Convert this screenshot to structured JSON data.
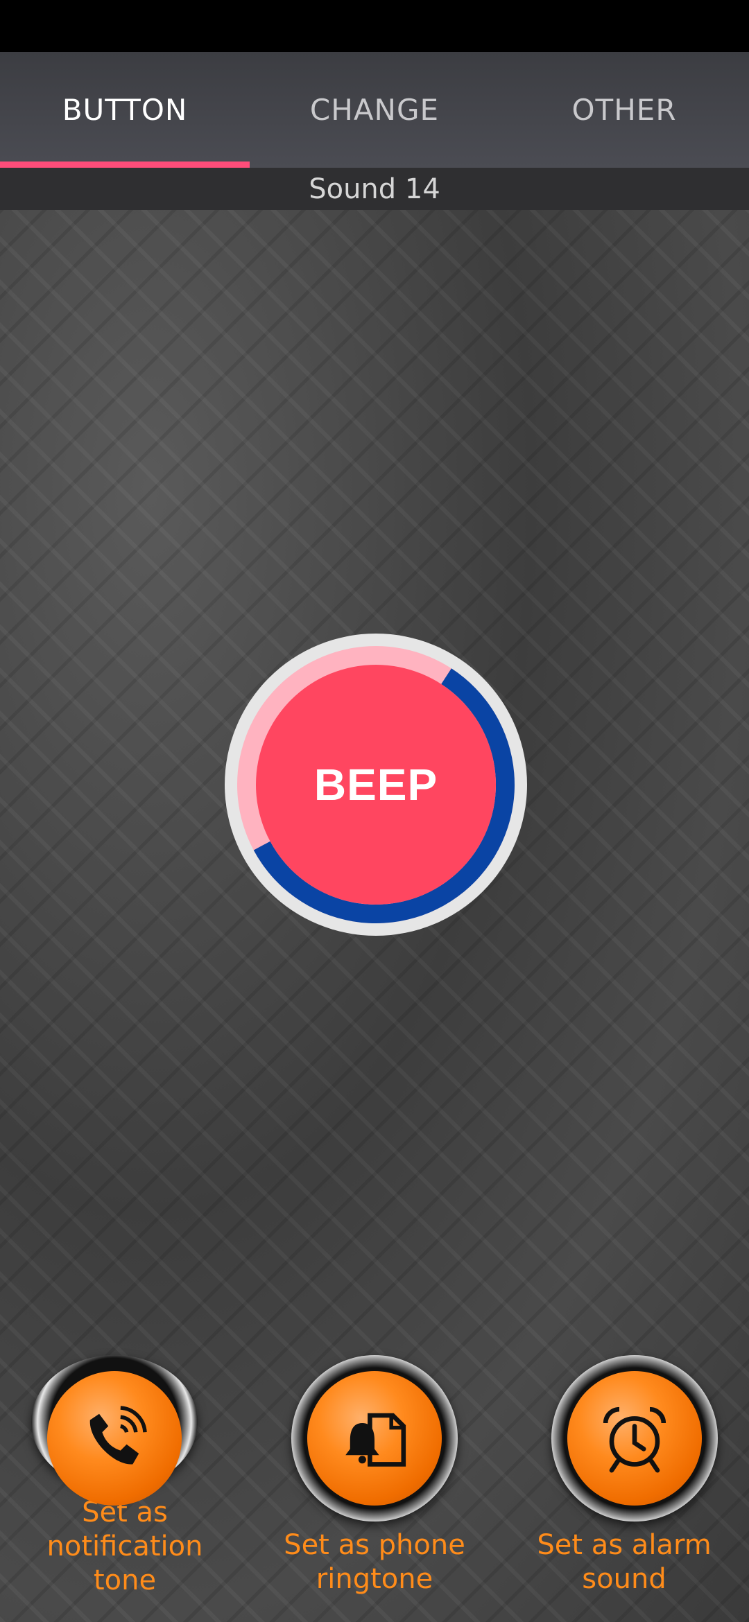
{
  "tabs": [
    {
      "label": "BUTTON",
      "active": true
    },
    {
      "label": "CHANGE",
      "active": false
    },
    {
      "label": "OTHER",
      "active": false
    }
  ],
  "sound_title": "Sound 14",
  "beep_button": {
    "label": "BEEP",
    "progress_fraction": 0.58,
    "colors": {
      "face": "#ff4660",
      "progress": "#0a44a4",
      "track": "#ffb3c0",
      "rim": "#e6e6e6"
    }
  },
  "actions": [
    {
      "label_line1": "Set as notification",
      "label_line2": "tone",
      "icon": "phone-ringing-icon"
    },
    {
      "label_line1": "Set as phone",
      "label_line2": "ringtone",
      "icon": "bell-document-icon"
    },
    {
      "label_line1": "Set as alarm",
      "label_line2": "sound",
      "icon": "alarm-clock-icon"
    }
  ],
  "colors": {
    "accent_tab": "#ff4d7a",
    "action_label": "#ff8c1a",
    "action_button": "#f07a10"
  }
}
